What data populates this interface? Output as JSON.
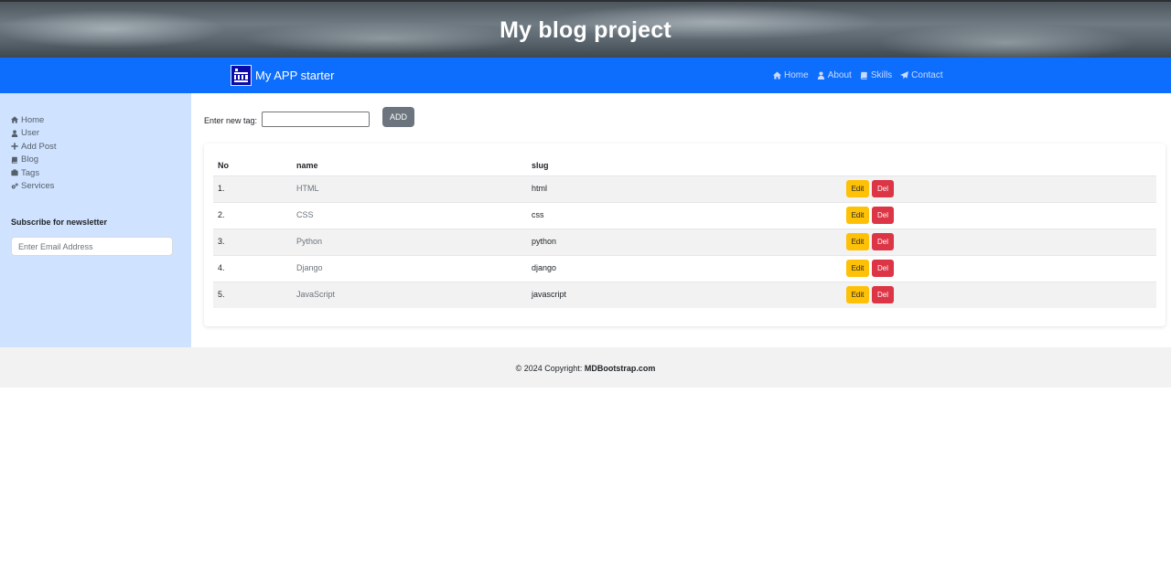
{
  "hero": {
    "title": "My blog project"
  },
  "navbar": {
    "brand": "My APP starter",
    "links": [
      {
        "label": "Home",
        "icon": "home-icon"
      },
      {
        "label": "About",
        "icon": "user-icon"
      },
      {
        "label": "Skills",
        "icon": "book-icon"
      },
      {
        "label": "Contact",
        "icon": "paper-plane-icon"
      }
    ]
  },
  "sidebar": {
    "items": [
      {
        "label": "Home",
        "icon": "home-icon"
      },
      {
        "label": "User",
        "icon": "user-icon"
      },
      {
        "label": "Add Post",
        "icon": "plus-icon"
      },
      {
        "label": "Blog",
        "icon": "book-icon"
      },
      {
        "label": "Tags",
        "icon": "tags-icon"
      },
      {
        "label": "Services",
        "icon": "cogs-icon"
      }
    ],
    "newsletter_title": "Subscribe for newsletter",
    "email_placeholder": "Enter Email Address"
  },
  "tag_form": {
    "label": "Enter new tag:",
    "value": "",
    "add_label": "ADD"
  },
  "table": {
    "headers": {
      "no": "No",
      "name": "name",
      "slug": "slug"
    },
    "rows": [
      {
        "no": "1.",
        "name": "HTML",
        "slug": "html"
      },
      {
        "no": "2.",
        "name": "CSS",
        "slug": "css"
      },
      {
        "no": "3.",
        "name": "Python",
        "slug": "python"
      },
      {
        "no": "4.",
        "name": "Django",
        "slug": "django"
      },
      {
        "no": "5.",
        "name": "JavaScript",
        "slug": "javascript"
      }
    ],
    "edit_label": "Edit",
    "del_label": "Del"
  },
  "footer": {
    "prefix": "© 2024 Copyright: ",
    "link": "MDBootstrap.com"
  },
  "colors": {
    "navbar": "#0d6efd",
    "sidebar": "#cfe2ff",
    "edit": "#ffc107",
    "delete": "#dc3545",
    "add": "#6c757d"
  }
}
